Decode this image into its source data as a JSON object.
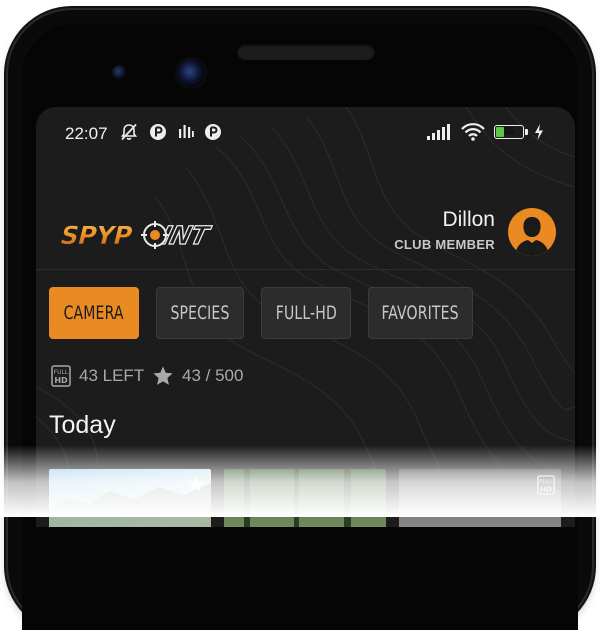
{
  "status_bar": {
    "time": "22:07",
    "left_icons": [
      "mute-icon",
      "notification-icon",
      "signal-bars-icon",
      "notification-icon"
    ],
    "right_icons": [
      "signal-icon",
      "wifi-icon",
      "battery-icon",
      "charging-icon"
    ],
    "battery_level": "26",
    "battery_fill_color": "#5ec54b"
  },
  "header": {
    "logo_text": "SPYPOINT",
    "user_name": "Dillon",
    "user_role": "CLUB MEMBER",
    "avatar_icon": "user-silhouette-icon"
  },
  "filters": {
    "tabs": [
      {
        "label": "CAMERA",
        "active": true
      },
      {
        "label": "SPECIES",
        "active": false
      },
      {
        "label": "FULL-HD",
        "active": false
      },
      {
        "label": "FAVORITES",
        "active": false
      }
    ]
  },
  "counts": {
    "hd_left": "43 LEFT",
    "favorites": "43 / 500",
    "hd_icon_top": "FULL",
    "hd_icon_bottom": "HD"
  },
  "section": {
    "title": "Today"
  },
  "thumbnails": [
    {
      "badge": "star-icon"
    },
    {
      "badge": ""
    },
    {
      "badge": "full-hd-badge-icon",
      "badge_text_top": "FULL",
      "badge_text_bottom": "HD"
    }
  ],
  "colors": {
    "accent": "#e98a22",
    "background": "#1c1c1c",
    "tab_background": "#2c2c2c"
  }
}
